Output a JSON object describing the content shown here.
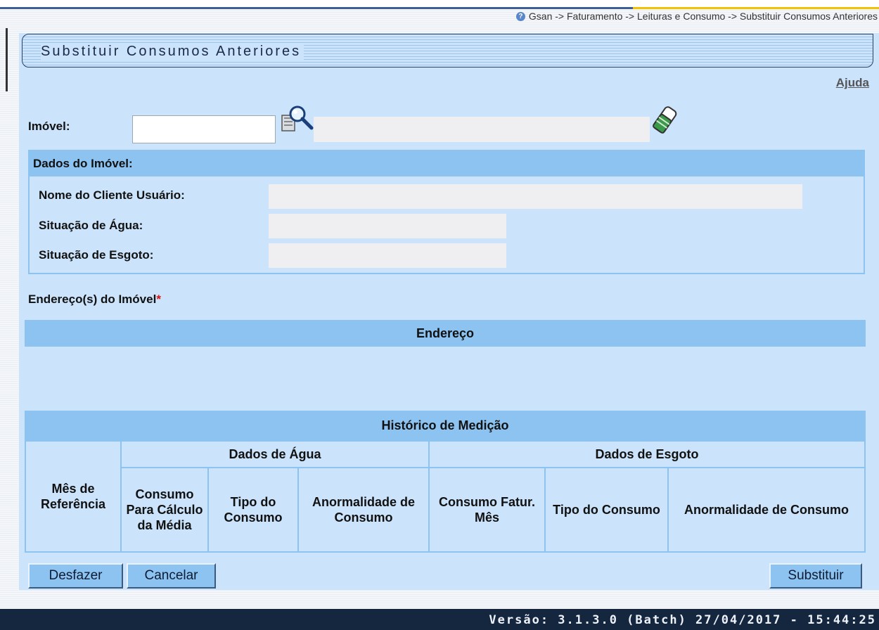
{
  "breadcrumb": "Gsan -> Faturamento -> Leituras e Consumo -> Substituir Consumos Anteriores",
  "page_title": "Substituir Consumos Anteriores",
  "help_link": "Ajuda",
  "form": {
    "imovel_label": "Imóvel:",
    "imovel_value": "",
    "imovel_description": ""
  },
  "dados_imovel": {
    "heading": "Dados do Imóvel:",
    "nome_cliente_label": "Nome do Cliente Usuário:",
    "nome_cliente_value": "",
    "situacao_agua_label": "Situação de Água:",
    "situacao_agua_value": "",
    "situacao_esgoto_label": "Situação de Esgoto:",
    "situacao_esgoto_value": ""
  },
  "enderecos": {
    "label": "Endereço(s) do Imóvel",
    "required_mark": "*",
    "column_header": "Endereço",
    "rows": []
  },
  "historico": {
    "title": "Histórico de Medição",
    "mes_referencia": "Mês de Referência",
    "dados_agua": "Dados de Água",
    "dados_esgoto": "Dados de Esgoto",
    "agua_columns": [
      "Consumo Para Cálculo da Média",
      "Tipo do Consumo",
      "Anormalidade de Consumo"
    ],
    "esgoto_columns": [
      "Consumo Fatur. Mês",
      "Tipo do Consumo",
      "Anormalidade de Consumo"
    ],
    "rows": []
  },
  "buttons": {
    "desfazer": "Desfazer",
    "cancelar": "Cancelar",
    "substituir": "Substituir"
  },
  "footer": {
    "version": "Versão: 3.1.3.0 (Batch) 27/04/2017 - 15:44:25"
  },
  "colors": {
    "panel_bg": "#cbe3fb",
    "header_blue": "#8cc3f1",
    "footer_bg": "#15263f"
  }
}
